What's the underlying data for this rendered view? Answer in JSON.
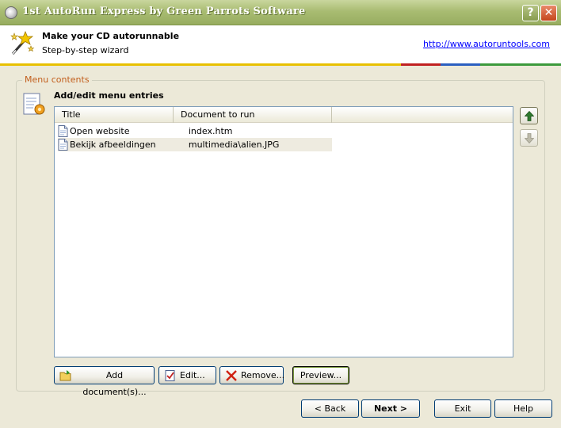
{
  "window": {
    "title": "1st AutoRun Express by Green Parrots Software",
    "help_button": "?",
    "close_button": "✕"
  },
  "header": {
    "title": "Make your CD autorunnable",
    "subtitle": "Step-by-step wizard",
    "link": "http://www.autoruntools.com"
  },
  "accent_colors": [
    "#E8C000",
    "#C02020",
    "#2A5FC0",
    "#3C9A3C"
  ],
  "group": {
    "label": "Menu contents",
    "section_title": "Add/edit menu entries"
  },
  "list": {
    "columns": [
      "Title",
      "Document to run"
    ],
    "rows": [
      {
        "title": "Open website",
        "document": "index.htm",
        "icon": "document-icon"
      },
      {
        "title": "Bekijk afbeeldingen",
        "document": "multimedia\\alien.JPG",
        "icon": "document-icon"
      }
    ]
  },
  "side_buttons": {
    "up": "move-up-arrow-icon",
    "down": "move-down-arrow-icon"
  },
  "actions": {
    "add": "Add document(s)...",
    "edit": "Edit...",
    "remove": "Remove...",
    "preview": "Preview..."
  },
  "nav": {
    "back": "< Back",
    "next": "Next >",
    "exit": "Exit",
    "help": "Help"
  }
}
